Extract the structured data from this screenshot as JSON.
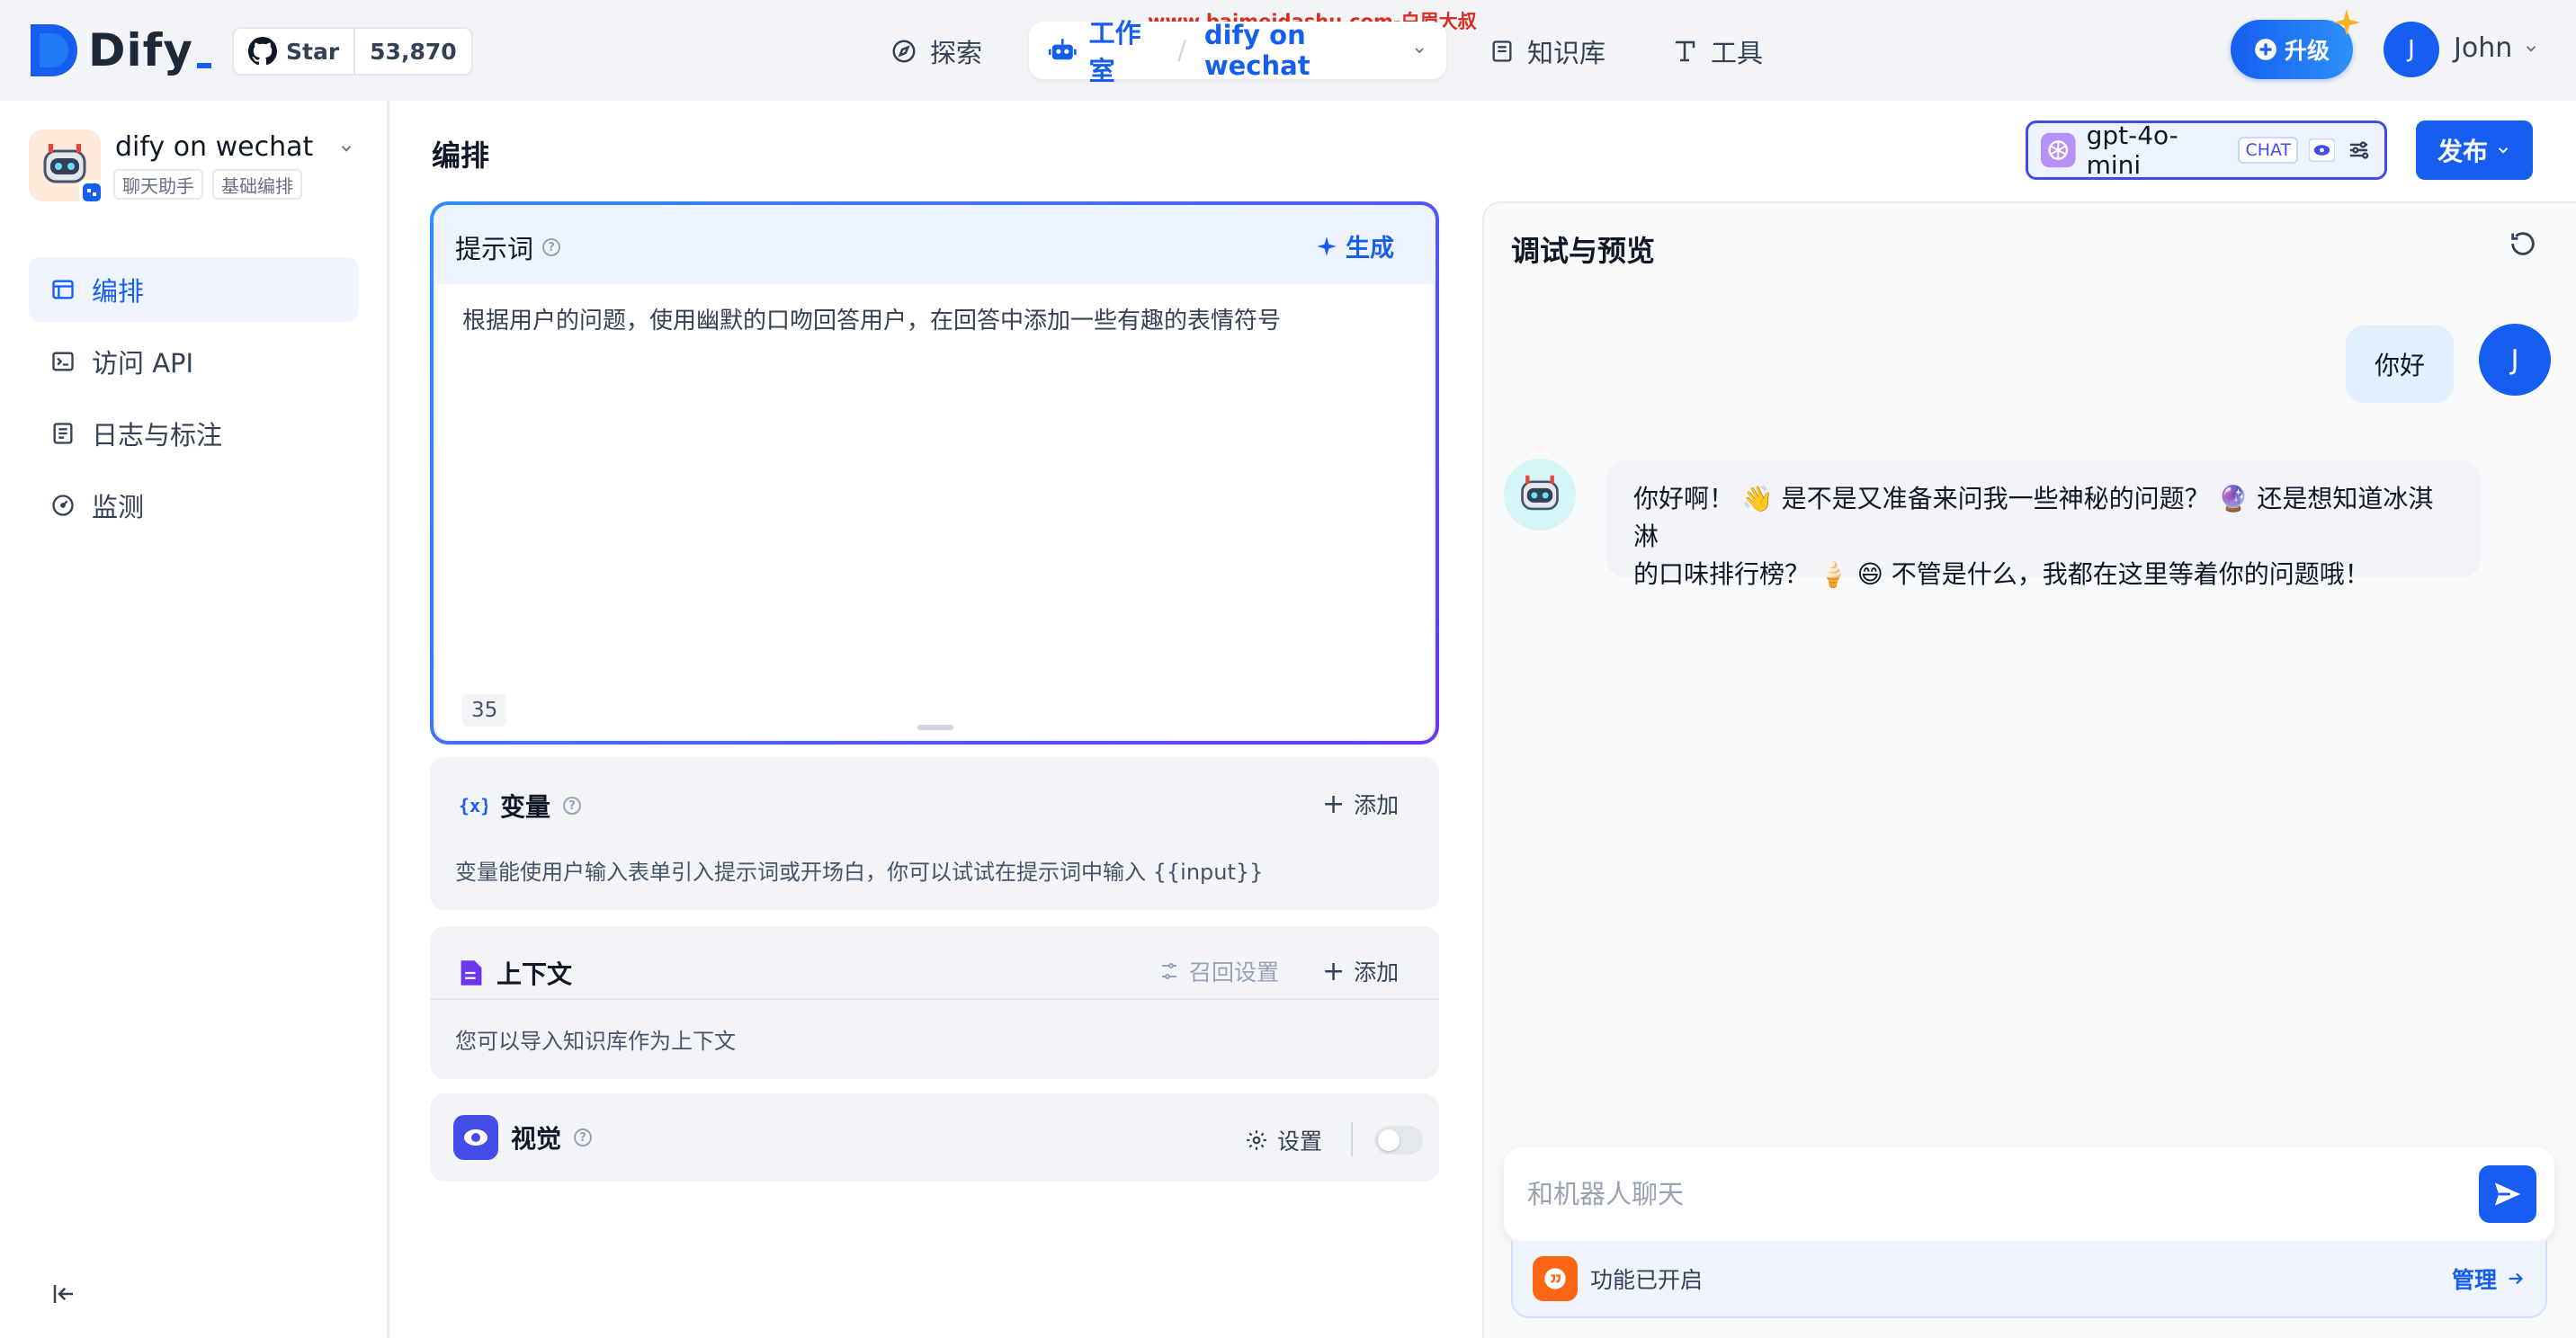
{
  "brand": {
    "name": "Dify"
  },
  "watermark": "www.baimeidashu.com-白眉大叔",
  "github": {
    "label": "Star",
    "count": "53,870"
  },
  "nav": {
    "explore": "探索",
    "studio": "工作室",
    "current_app": "dify on wechat",
    "knowledge": "知识库",
    "tools": "工具"
  },
  "upgrade_label": "升级",
  "user": {
    "initial": "J",
    "name": "John"
  },
  "app": {
    "name": "dify on wechat",
    "tags": [
      "聊天助手",
      "基础编排"
    ]
  },
  "sidebar": {
    "items": [
      {
        "label": "编排",
        "icon": "layout-icon",
        "active": true
      },
      {
        "label": "访问 API",
        "icon": "terminal-icon",
        "active": false
      },
      {
        "label": "日志与标注",
        "icon": "log-icon",
        "active": false
      },
      {
        "label": "监测",
        "icon": "gauge-icon",
        "active": false
      }
    ]
  },
  "main": {
    "title": "编排",
    "model": {
      "name": "gpt-4o-mini",
      "badge": "CHAT"
    },
    "publish_label": "发布"
  },
  "prompt": {
    "label": "提示词",
    "generate_label": "生成",
    "text": "根据用户的问题，使用幽默的口吻回答用户，在回答中添加一些有趣的表情符号",
    "char_count": "35"
  },
  "variables": {
    "title": "变量",
    "add_label": "添加",
    "description": "变量能使用户输入表单引入提示词或开场白，你可以试试在提示词中输入 {{input}}"
  },
  "context": {
    "title": "上下文",
    "recall_label": "召回设置",
    "add_label": "添加",
    "description": "您可以导入知识库作为上下文"
  },
  "vision": {
    "title": "视觉",
    "settings_label": "设置",
    "enabled": false
  },
  "chat": {
    "title": "调试与预览",
    "user_message": "你好",
    "bot_message_line1": "你好啊！ 👋 是不是又准备来问我一些神秘的问题？ 🔮 还是想知道冰淇淋",
    "bot_message_line2": "的口味排行榜？ 🍦 😄 不管是什么，我都在这里等着你的问题哦！",
    "input_placeholder": "和机器人聊天",
    "feature_status": "功能已开启",
    "manage_label": "管理"
  },
  "colors": {
    "primary": "#155eef",
    "accent_purple": "#6938ef",
    "feature_orange": "#fb6514"
  }
}
